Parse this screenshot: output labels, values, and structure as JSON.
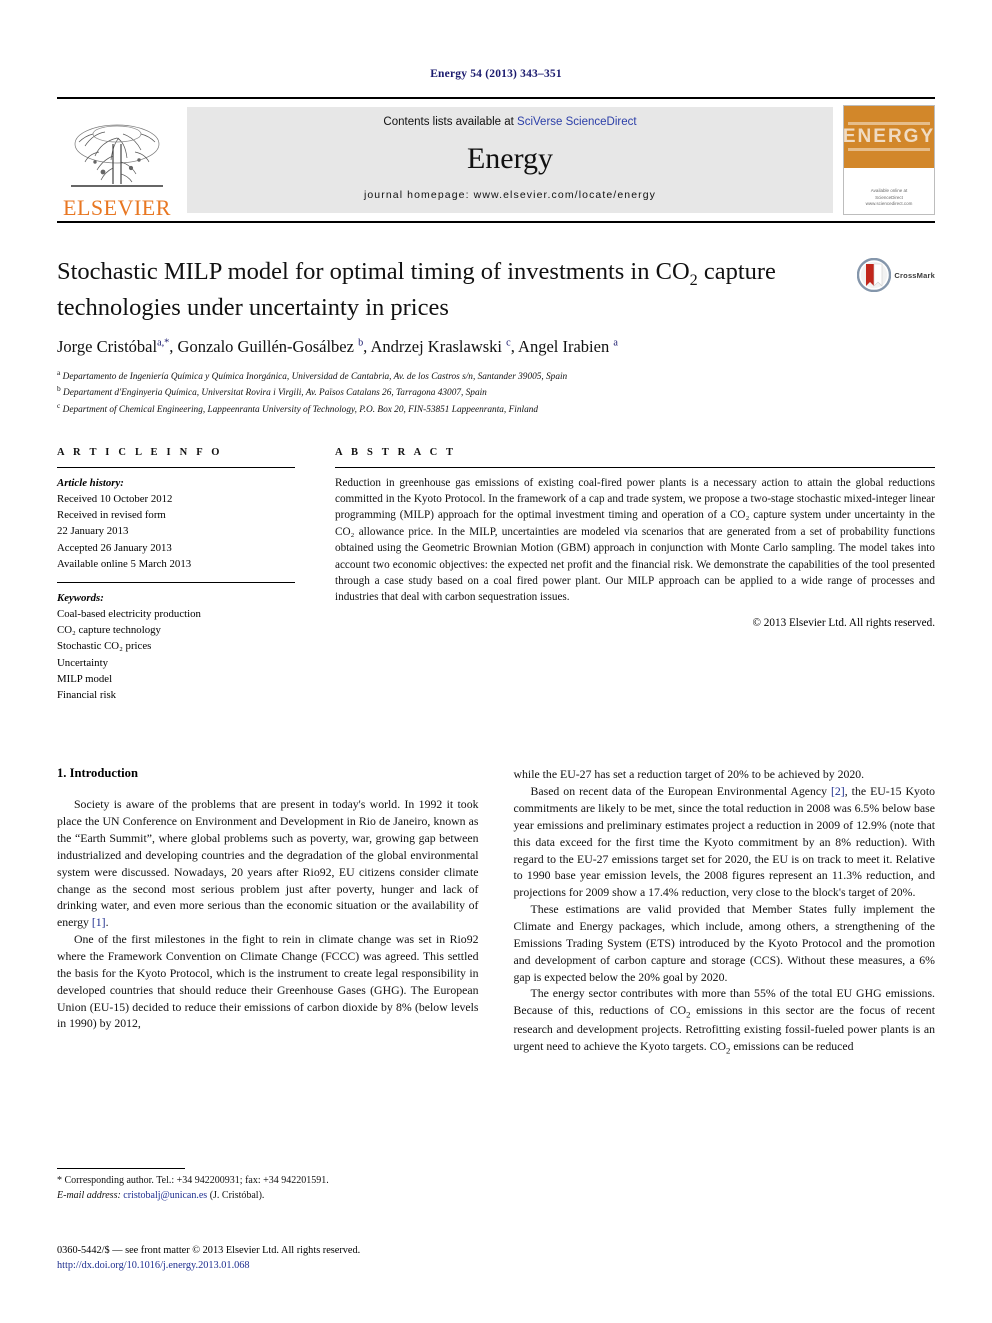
{
  "running_head": "Energy 54 (2013) 343–351",
  "masthead": {
    "contents_prefix": "Contents lists available at ",
    "contents_link": "SciVerse ScienceDirect",
    "journal_title": "Energy",
    "homepage": "journal homepage: www.elsevier.com/locate/energy",
    "publisher_wordmark": "ELSEVIER",
    "cover_title": "ENERGY",
    "cover_footer": "Available online at\nScienceDirect\nwww.sciencedirect.com"
  },
  "title_block": {
    "title_part1": "Stochastic MILP model for optimal timing of investments in CO",
    "title_sub": "2",
    "title_part2": " capture technologies under uncertainty in prices",
    "authors": "Jorge Cristóbal, Gonzalo Guillén-Gosálbez, Andrzej Kraslawski, Angel Irabien",
    "crossmark_label": "CrossMark",
    "affiliations": [
      "Departamento de Ingeniería Química y Química Inorgánica, Universidad de Cantabria, Av. de los Castros s/n, Santander 39005, Spain",
      "Departament d'Enginyeria Química, Universitat Rovira i Virgili, Av. Països Catalans 26, Tarragona 43007, Spain",
      "Department of Chemical Engineering, Lappeenranta University of Technology, P.O. Box 20, FIN-53851 Lappeenranta, Finland"
    ]
  },
  "article_info": {
    "heading": "A R T I C L E   I N F O",
    "history_label": "Article history:",
    "history": [
      "Received 10 October 2012",
      "Received in revised form",
      "22 January 2013",
      "Accepted 26 January 2013",
      "Available online 5 March 2013"
    ],
    "keywords_label": "Keywords:",
    "keywords": [
      "Coal-based electricity production",
      "CO₂ capture technology",
      "Stochastic CO₂ prices",
      "Uncertainty",
      "MILP model",
      "Financial risk"
    ]
  },
  "abstract": {
    "heading": "A B S T R A C T",
    "text": "Reduction in greenhouse gas emissions of existing coal-fired power plants is a necessary action to attain the global reductions committed in the Kyoto Protocol. In the framework of a cap and trade system, we propose a two-stage stochastic mixed-integer linear programming (MILP) approach for the optimal investment timing and operation of a CO₂ capture system under uncertainty in the CO₂ allowance price. In the MILP, uncertainties are modeled via scenarios that are generated from a set of probability functions obtained using the Geometric Brownian Motion (GBM) approach in conjunction with Monte Carlo sampling. The model takes into account two economic objectives: the expected net profit and the financial risk. We demonstrate the capabilities of the tool presented through a case study based on a coal fired power plant. Our MILP approach can be applied to a wide range of processes and industries that deal with carbon sequestration issues.",
    "copyright": "© 2013 Elsevier Ltd. All rights reserved."
  },
  "body": {
    "section_heading": "1. Introduction",
    "left_paragraphs": [
      "Society is aware of the problems that are present in today's world. In 1992 it took place the UN Conference on Environment and Development in Rio de Janeiro, known as the “Earth Summit”, where global problems such as poverty, war, growing gap between industrialized and developing countries and the degradation of the global environmental system were discussed. Nowadays, 20 years after Rio92, EU citizens consider climate change as the second most serious problem just after poverty, hunger and lack of drinking water, and even more serious than the economic situation or the availability of energy [1].",
      "One of the first milestones in the fight to rein in climate change was set in Rio92 where the Framework Convention on Climate Change (FCCC) was agreed. This settled the basis for the Kyoto Protocol, which is the instrument to create legal responsibility in developed countries that should reduce their Greenhouse Gases (GHG). The European Union (EU-15) decided to reduce their emissions of carbon dioxide by 8% (below levels in 1990) by 2012,"
    ],
    "right_paragraphs": [
      "while the EU-27 has set a reduction target of 20% to be achieved by 2020.",
      "Based on recent data of the European Environmental Agency [2], the EU-15 Kyoto commitments are likely to be met, since the total reduction in 2008 was 6.5% below base year emissions and preliminary estimates project a reduction in 2009 of 12.9% (note that this data exceed for the first time the Kyoto commitment by an 8% reduction). With regard to the EU-27 emissions target set for 2020, the EU is on track to meet it. Relative to 1990 base year emission levels, the 2008 figures represent an 11.3% reduction, and projections for 2009 show a 17.4% reduction, very close to the block's target of 20%.",
      "These estimations are valid provided that Member States fully implement the Climate and Energy packages, which include, among others, a strengthening of the Emissions Trading System (ETS) introduced by the Kyoto Protocol and the promotion and development of carbon capture and storage (CCS). Without these measures, a 6% gap is expected below the 20% goal by 2020.",
      "The energy sector contributes with more than 55% of the total EU GHG emissions. Because of this, reductions of CO₂ emissions in this sector are the focus of recent research and development projects. Retrofitting existing fossil-fueled power plants is an urgent need to achieve the Kyoto targets. CO₂ emissions can be reduced"
    ]
  },
  "footnotes": {
    "corresponding": "* Corresponding author. Tel.: +34 942200931; fax: +34 942201591.",
    "email_label": "E-mail address:",
    "email": "cristobalj@unican.es",
    "email_owner": "(J. Cristóbal).",
    "issn_line": "0360-5442/$ — see front matter © 2013 Elsevier Ltd. All rights reserved.",
    "doi": "http://dx.doi.org/10.1016/j.energy.2013.01.068"
  },
  "colors": {
    "link_blue": "#2b3ea8",
    "ref_blue": "#1f2f8f",
    "elsevier_orange": "#E87722",
    "band_grey": "#e7e7e7",
    "cover_orange": "#D2872A"
  }
}
